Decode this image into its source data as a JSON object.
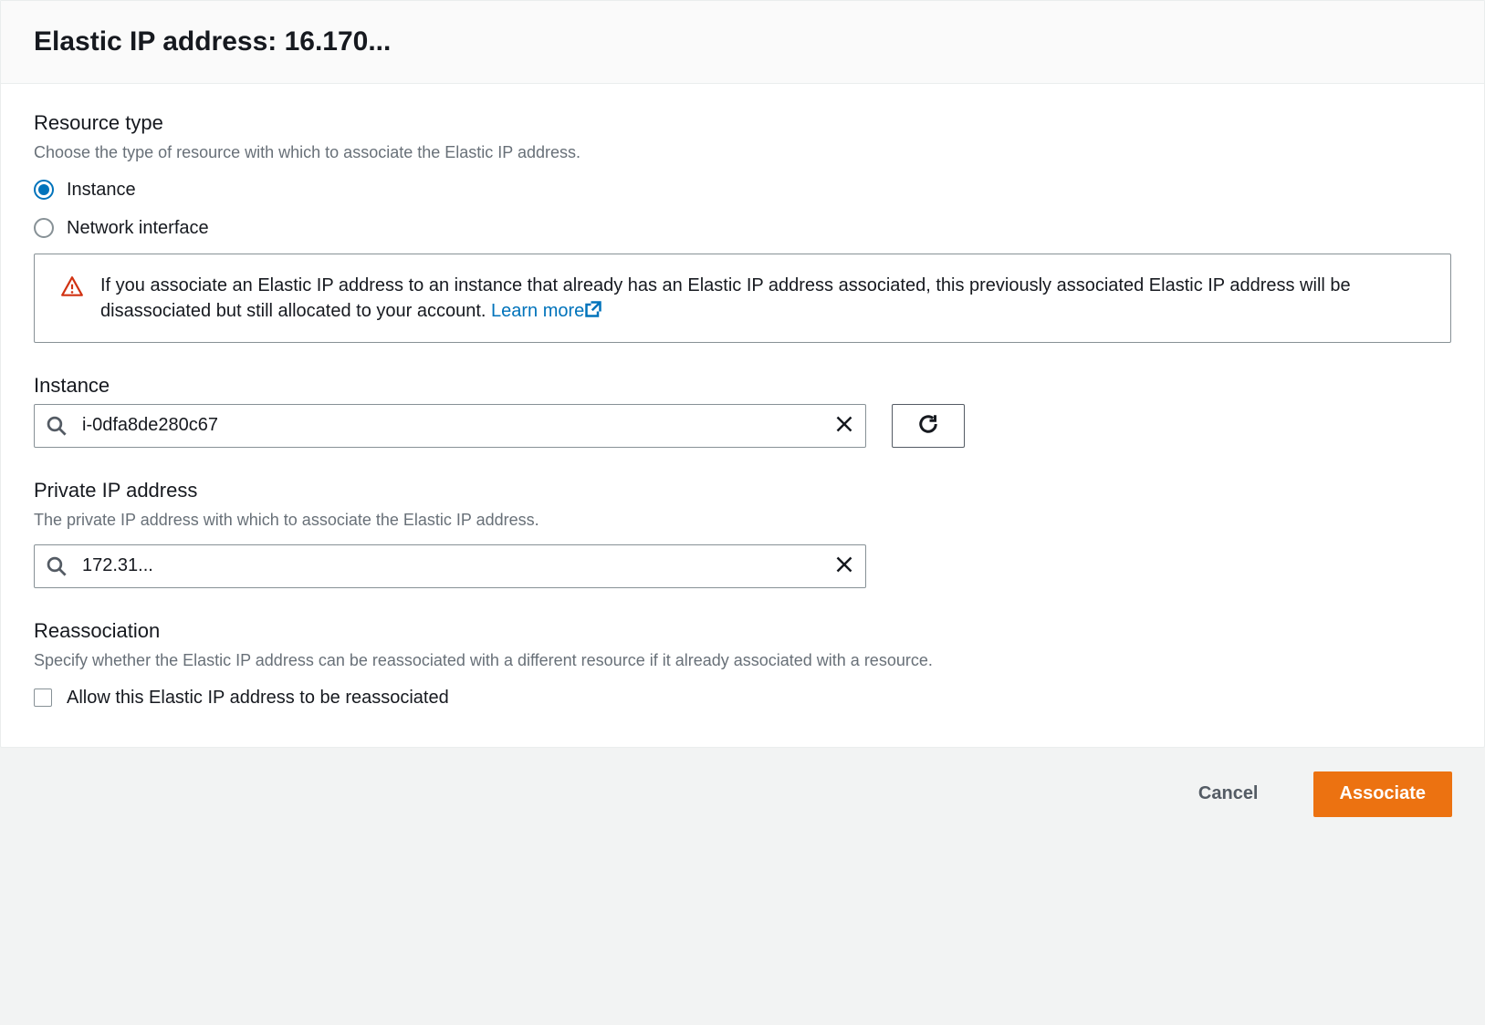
{
  "header": {
    "title": "Elastic IP address: 16.170..."
  },
  "resource_type": {
    "title": "Resource type",
    "desc": "Choose the type of resource with which to associate the Elastic IP address.",
    "options": {
      "instance": "Instance",
      "network_interface": "Network interface"
    },
    "selected": "instance"
  },
  "warning": {
    "text": "If you associate an Elastic IP address to an instance that already has an Elastic IP address associated, this previously associated Elastic IP address will be disassociated but still allocated to your account. ",
    "learn_more": "Learn more"
  },
  "instance": {
    "title": "Instance",
    "value": "i-0dfa8de280c67"
  },
  "private_ip": {
    "title": "Private IP address",
    "desc": "The private IP address with which to associate the Elastic IP address.",
    "value": "172.31..."
  },
  "reassociation": {
    "title": "Reassociation",
    "desc": "Specify whether the Elastic IP address can be reassociated with a different resource if it already associated with a resource.",
    "checkbox_label": "Allow this Elastic IP address to be reassociated",
    "checked": false
  },
  "footer": {
    "cancel": "Cancel",
    "associate": "Associate"
  }
}
